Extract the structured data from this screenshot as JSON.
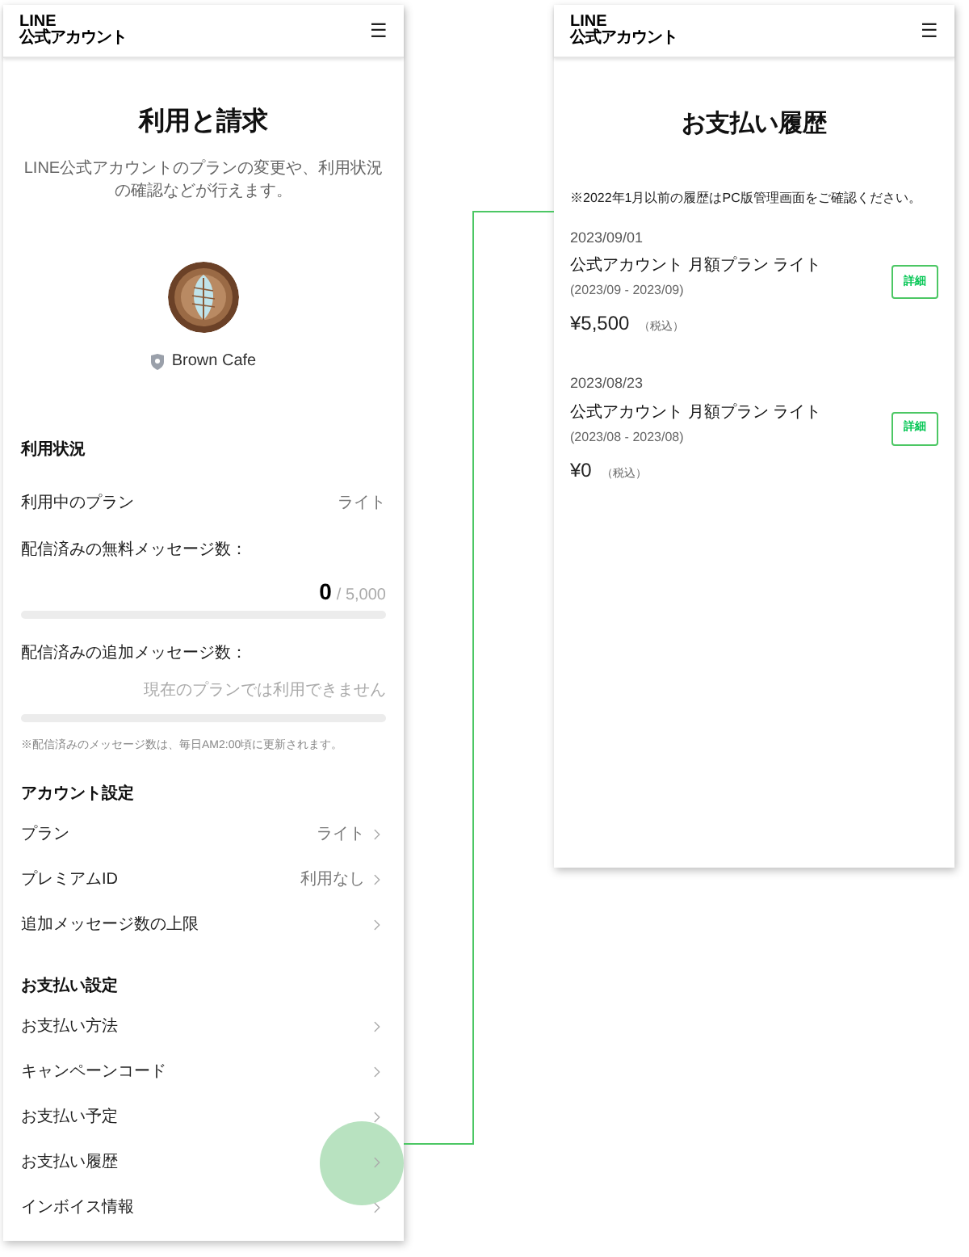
{
  "left_screen": {
    "logo": {
      "line1": "LINE",
      "line2": "公式アカウント"
    },
    "menu_icon": "☰",
    "title": "利用と請求",
    "description": "LINE公式アカウントのプランの変更や、利用状況の確認などが行えます。",
    "account_name": "Brown Cafe",
    "usage": {
      "heading": "利用状況",
      "plan_label": "利用中のプラン",
      "plan_value": "ライト",
      "meters": [
        {
          "label": "配信済みの無料メッセージ数：",
          "count": "0",
          "total": "/ 5,000",
          "level": 0
        },
        {
          "label": "配信済みの追加メッセージ数：",
          "unavailable": "現在のプランでは利用できません",
          "level": 0
        }
      ],
      "note": "※配信済みのメッセージ数は、毎日AM2:00頃に更新されます。"
    },
    "sections": [
      {
        "heading": "アカウント設定",
        "items": [
          {
            "label": "プラン",
            "value": "ライト",
            "highlighted": false
          },
          {
            "label": "プレミアムID",
            "value": "利用なし",
            "highlighted": false
          },
          {
            "label": "追加メッセージ数の上限",
            "highlighted": false
          }
        ]
      },
      {
        "heading": "お支払い設定",
        "items": [
          {
            "label": "お支払い方法",
            "highlighted": false
          },
          {
            "label": "キャンペーンコード",
            "highlighted": false
          },
          {
            "label": "お支払い予定",
            "highlighted": false
          },
          {
            "label": "お支払い履歴",
            "highlighted": true
          },
          {
            "label": "インボイス情報",
            "highlighted": false
          }
        ]
      }
    ]
  },
  "right_screen": {
    "logo": {
      "line1": "LINE",
      "line2": "公式アカウント"
    },
    "menu_icon": "☰",
    "title": "お支払い履歴",
    "note": "※2022年1月以前の履歴はPC版管理画面をご確認ください。",
    "payments": [
      {
        "date": "2023/09/01",
        "plan": "公式アカウント 月額プラン ライト",
        "period": "(2023/09 - 2023/09)",
        "amount": "¥5,500",
        "tax": "（税込）",
        "button": "詳細"
      },
      {
        "date": "2023/08/23",
        "plan": "公式アカウント 月額プラン ライト",
        "period": "(2023/08 - 2023/08)",
        "amount": "¥0",
        "tax": "（税込）",
        "button": "詳細"
      }
    ]
  }
}
